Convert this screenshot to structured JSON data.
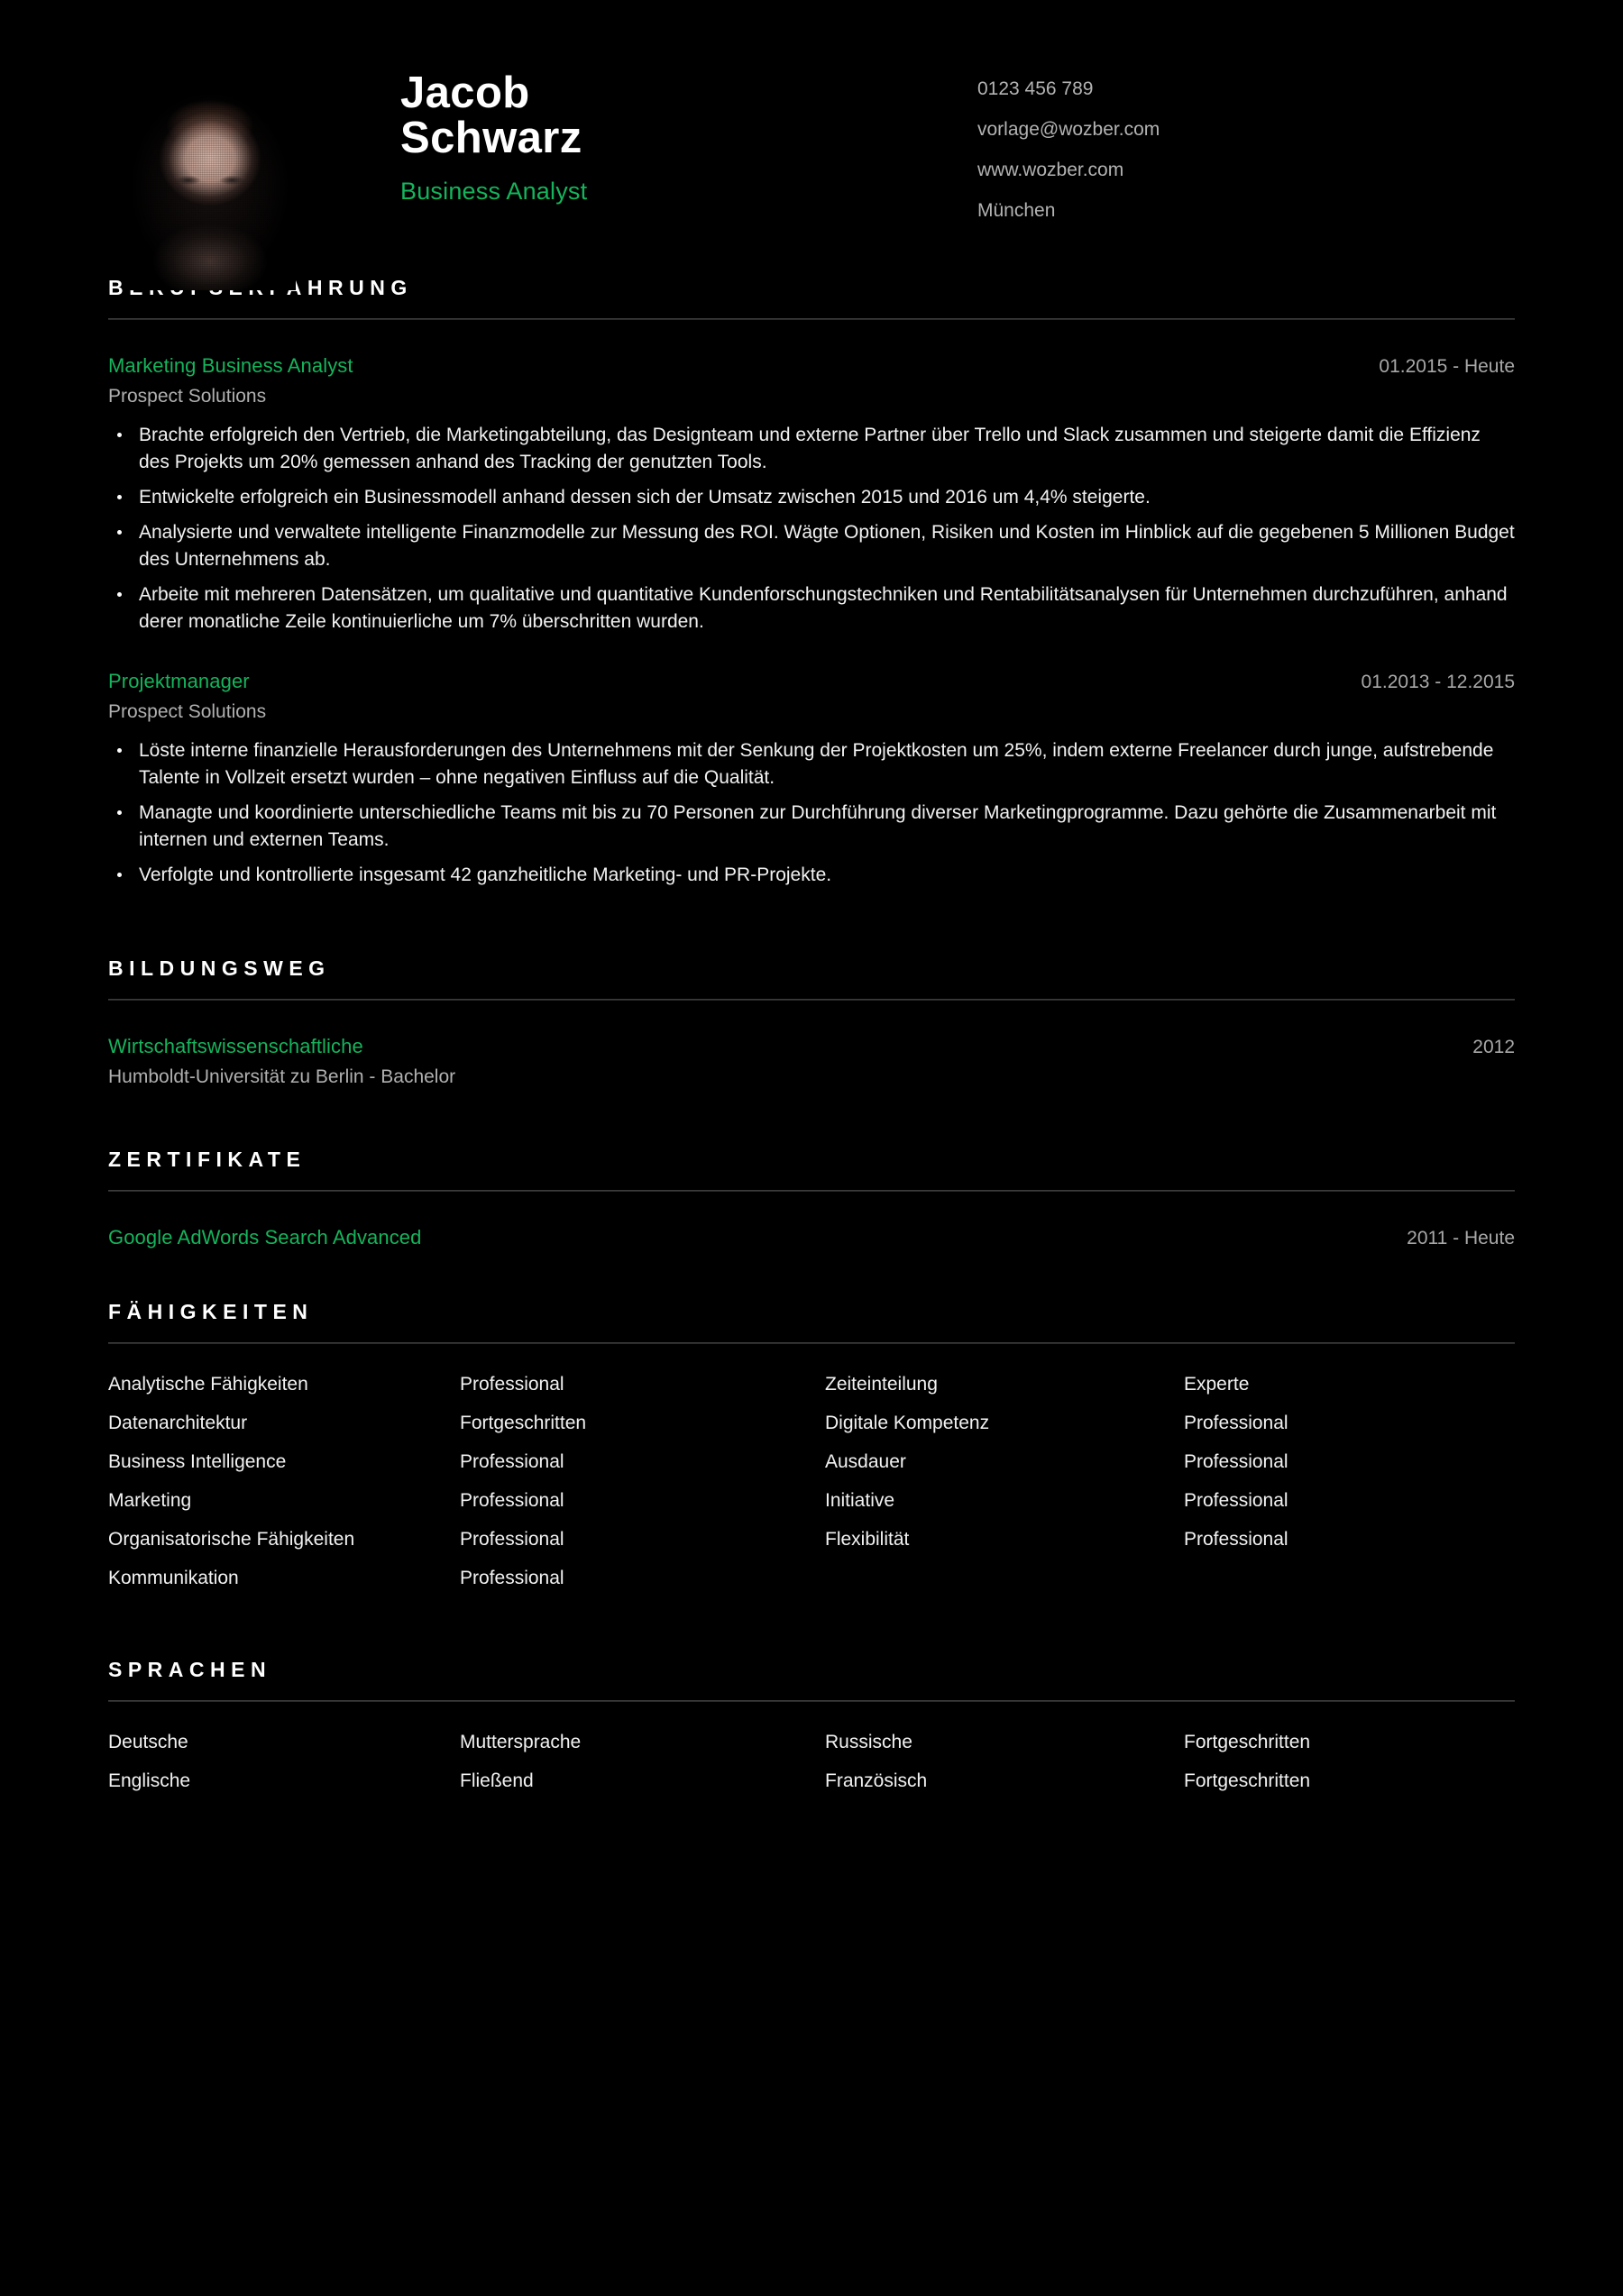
{
  "header": {
    "first_name": "Jacob",
    "last_name": "Schwarz",
    "job_title": "Business Analyst",
    "photo_alt": "portrait-photo",
    "contact": [
      "0123 456 789",
      "vorlage@wozber.com",
      "www.wozber.com",
      "München"
    ]
  },
  "accent_color": "#15b45c",
  "sections": {
    "experience": {
      "title": "BERUFSERFAHRUNG",
      "entries": [
        {
          "role": "Marketing Business Analyst",
          "date": "01.2015 - Heute",
          "org": "Prospect Solutions",
          "bullets": [
            "Brachte erfolgreich den Vertrieb, die Marketingabteilung, das Designteam und externe Partner über Trello und Slack zusammen und steigerte damit die Effizienz des Projekts um 20% gemessen anhand des Tracking der genutzten Tools.",
            "Entwickelte erfolgreich ein Businessmodell anhand dessen sich der Umsatz zwischen 2015 und 2016 um 4,4% steigerte.",
            "Analysierte und verwaltete intelligente Finanzmodelle zur Messung des ROI. Wägte Optionen, Risiken und Kosten im Hinblick auf die gegebenen 5 Millionen Budget des Unternehmens ab.",
            "Arbeite mit mehreren Datensätzen, um qualitative und quantitative Kundenforschungstechniken und Rentabilitätsanalysen für Unternehmen durchzuführen, anhand derer monatliche Zeile kontinuierliche um 7% überschritten wurden."
          ]
        },
        {
          "role": "Projektmanager",
          "date": "01.2013 - 12.2015",
          "org": "Prospect Solutions",
          "bullets": [
            "Löste interne finanzielle Herausforderungen des Unternehmens mit der Senkung der Projektkosten um 25%, indem externe Freelancer durch junge, aufstrebende Talente in Vollzeit ersetzt wurden – ohne negativen Einfluss auf die Qualität.",
            "Managte und koordinierte unterschiedliche Teams mit bis zu 70 Personen zur Durchführung diverser Marketingprogramme. Dazu gehörte die Zusammenarbeit mit internen und externen Teams.",
            "Verfolgte und kontrollierte insgesamt 42 ganzheitliche Marketing- und PR-Projekte."
          ]
        }
      ]
    },
    "education": {
      "title": "BILDUNGSWEG",
      "entries": [
        {
          "degree": "Wirtschaftswissenschaftliche",
          "date": "2012",
          "school": "Humboldt-Universität zu Berlin - Bachelor"
        }
      ]
    },
    "certificates": {
      "title": "ZERTIFIKATE",
      "entries": [
        {
          "name": "Google AdWords Search Advanced",
          "date": "2011 - Heute"
        }
      ]
    },
    "skills": {
      "title": "FÄHIGKEITEN",
      "rows": [
        {
          "skill_a": "Analytische Fähigkeiten",
          "level_a": "Professional",
          "skill_b": "Zeiteinteilung",
          "level_b": "Experte"
        },
        {
          "skill_a": "Datenarchitektur",
          "level_a": "Fortgeschritten",
          "skill_b": "Digitale Kompetenz",
          "level_b": "Professional"
        },
        {
          "skill_a": "Business Intelligence",
          "level_a": "Professional",
          "skill_b": "Ausdauer",
          "level_b": "Professional"
        },
        {
          "skill_a": "Marketing",
          "level_a": "Professional",
          "skill_b": "Initiative",
          "level_b": "Professional"
        },
        {
          "skill_a": "Organisatorische Fähigkeiten",
          "level_a": "Professional",
          "skill_b": "Flexibilität",
          "level_b": "Professional"
        },
        {
          "skill_a": "Kommunikation",
          "level_a": "Professional",
          "skill_b": "",
          "level_b": ""
        }
      ]
    },
    "languages": {
      "title": "SPRACHEN",
      "rows": [
        {
          "lang_a": "Deutsche",
          "level_a": "Muttersprache",
          "lang_b": "Russische",
          "level_b": "Fortgeschritten"
        },
        {
          "lang_a": "Englische",
          "level_a": "Fließend",
          "lang_b": "Französisch",
          "level_b": "Fortgeschritten"
        }
      ]
    }
  }
}
